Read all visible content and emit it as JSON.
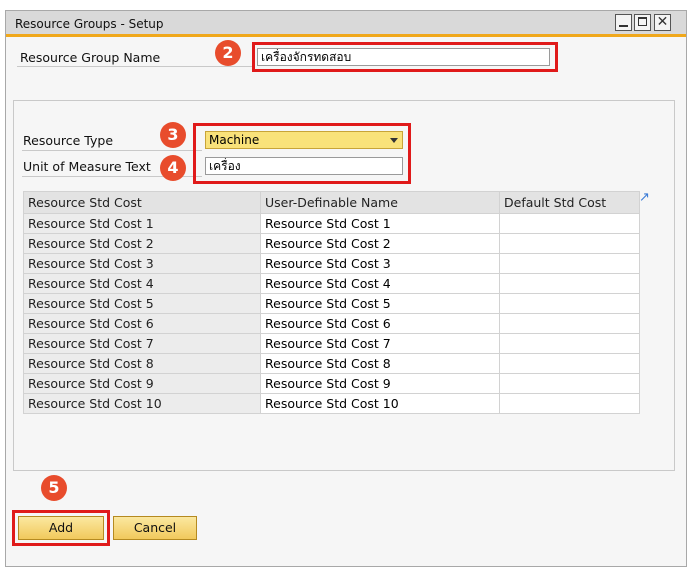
{
  "window": {
    "title": "Resource Groups - Setup"
  },
  "form": {
    "group_name_label": "Resource Group Name",
    "group_name_value": "เครื่องจักรทดสอบ",
    "resource_type_label": "Resource Type",
    "resource_type_value": "Machine",
    "uom_label": "Unit of Measure Text",
    "uom_value": "เครื่อง"
  },
  "table": {
    "headers": [
      "Resource Std Cost",
      "User-Definable Name",
      "Default Std Cost"
    ],
    "rows": [
      [
        "Resource Std Cost 1",
        "Resource Std Cost 1",
        ""
      ],
      [
        "Resource Std Cost 2",
        "Resource Std Cost 2",
        ""
      ],
      [
        "Resource Std Cost 3",
        "Resource Std Cost 3",
        ""
      ],
      [
        "Resource Std Cost 4",
        "Resource Std Cost 4",
        ""
      ],
      [
        "Resource Std Cost 5",
        "Resource Std Cost 5",
        ""
      ],
      [
        "Resource Std Cost 6",
        "Resource Std Cost 6",
        ""
      ],
      [
        "Resource Std Cost 7",
        "Resource Std Cost 7",
        ""
      ],
      [
        "Resource Std Cost 8",
        "Resource Std Cost 8",
        ""
      ],
      [
        "Resource Std Cost 9",
        "Resource Std Cost 9",
        ""
      ],
      [
        "Resource Std Cost 10",
        "Resource Std Cost 10",
        ""
      ]
    ]
  },
  "buttons": {
    "add": "Add",
    "cancel": "Cancel"
  },
  "annotations": {
    "step2": "2",
    "step3": "3",
    "step4": "4",
    "step5": "5"
  },
  "icons": {
    "minimize": "minimize-icon",
    "maximize": "maximize-icon",
    "close": "close-icon",
    "expand": "expand-table-icon",
    "dropdown": "chevron-down-icon"
  },
  "colors": {
    "accent": "#f0a81c",
    "annotation": "#e01a1a",
    "badge": "#e84c2c",
    "select_bg": "#f9e27a"
  }
}
